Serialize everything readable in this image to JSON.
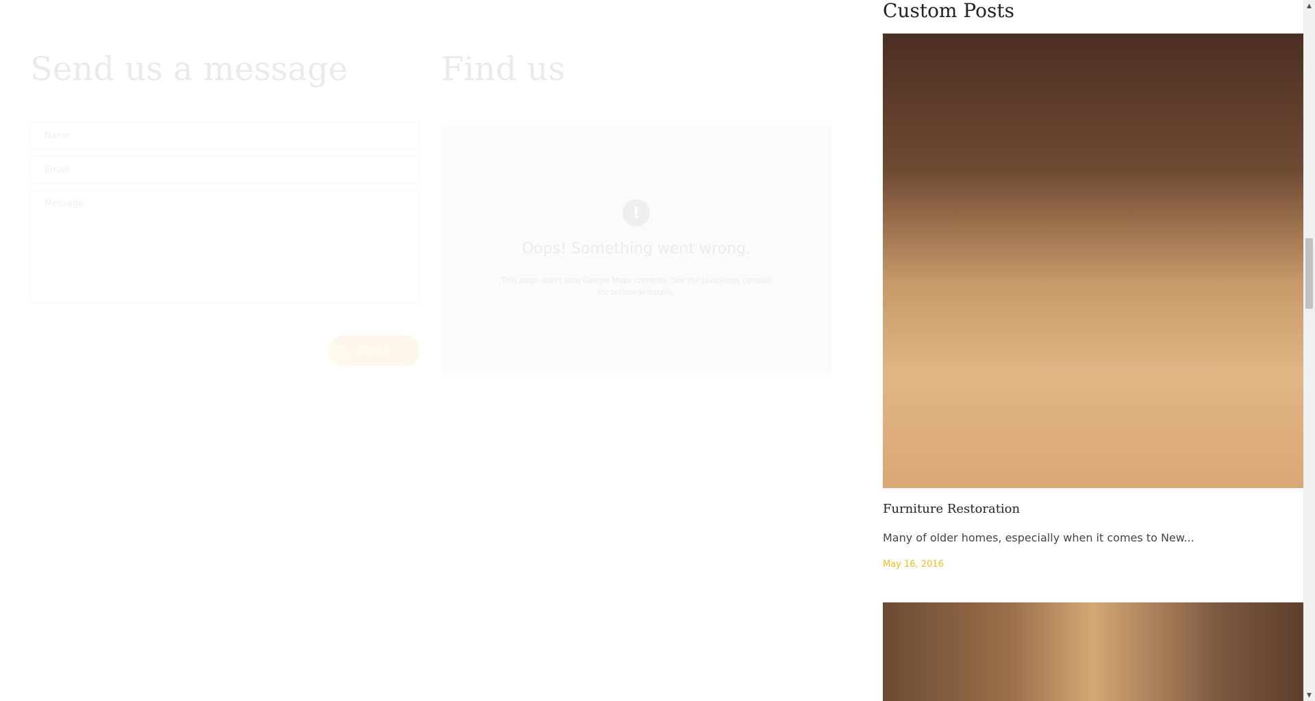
{
  "contact": {
    "title": "Send us a message",
    "name_placeholder": "Name",
    "email_placeholder": "Email",
    "message_placeholder": "Message",
    "send_label": "Send",
    "send_arrow": "›"
  },
  "map": {
    "title": "Find us",
    "error_title": "Oops! Something went wrong.",
    "error_description": "This page didn't load Google Maps correctly. See the JavaScript console for technical details.",
    "error_icon": "!"
  },
  "sidebar": {
    "heading": "Custom Posts",
    "posts": [
      {
        "title": "Furniture Restoration",
        "excerpt": "Many of older homes, especially when it comes to New...",
        "date": "May 16, 2016"
      }
    ]
  },
  "scrollbar": {
    "up_arrow": "▲",
    "down_arrow": "▼"
  },
  "colors": {
    "accent": "#f4bc16",
    "text": "#222222",
    "background": "#ffffff"
  }
}
